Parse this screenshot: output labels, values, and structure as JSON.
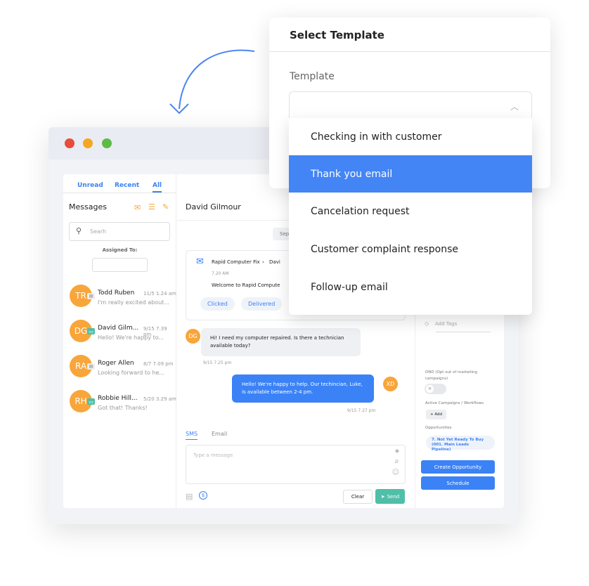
{
  "window": {
    "controls": [
      "close",
      "minimize",
      "maximize"
    ],
    "colors": {
      "close": "#e74c3c",
      "minimize": "#f5a623",
      "maximize": "#5dbb46"
    }
  },
  "sidebar": {
    "tabs": [
      {
        "label": "Unread"
      },
      {
        "label": "Recent"
      },
      {
        "label": "All",
        "active": true
      }
    ],
    "title": "Messages",
    "search_placeholder": "Searh",
    "assigned_label": "Assigned To:",
    "conversations": [
      {
        "initials": "TR",
        "name": "Todd Ruben",
        "time": "11/5 1.24 am",
        "preview": "I'm really excited about...",
        "channel": "email"
      },
      {
        "initials": "DG",
        "name": "David Gilm...",
        "time": "9/15 7.39 pm",
        "preview": "Hello! We're happy to...",
        "channel": "sms"
      },
      {
        "initials": "RA",
        "name": "Roger Allen",
        "time": "8/7 7.09 pm",
        "preview": "Looking forward to he...",
        "channel": "email"
      },
      {
        "initials": "RH",
        "name": "Robbie Hill...",
        "time": "5/20 3.29 am",
        "preview": "Got that! Thanks!",
        "channel": "sms"
      }
    ]
  },
  "chat": {
    "contact_name": "David Gilmour",
    "date_chip": "Sep",
    "email_card": {
      "from": "Rapid Computer Fix",
      "to": "Davi",
      "time": "7.20 AM",
      "subject": "Welcome to Rapid Compute",
      "statuses": [
        "Clicked",
        "Delivered"
      ]
    },
    "messages": [
      {
        "initials": "DG",
        "text": "Hi! I need my computer repaired. Is there a technician available today?",
        "time": "9/15 7.25 pm",
        "direction": "in"
      },
      {
        "initials": "XD",
        "text": "Hello! We're happy to help. Our techincian, Luke, is available between 2-4 pm.",
        "time": "9/15 7.27 pm",
        "direction": "out"
      }
    ],
    "composer": {
      "tabs": [
        "SMS",
        "Email"
      ],
      "active_tab": "SMS",
      "placeholder": "Type a message",
      "clear_label": "Clear",
      "send_label": "Send"
    }
  },
  "details": {
    "add_tags": "Add Tags",
    "dnd_label": "DND (Opt out of marketing campaigns)",
    "dnd_on": false,
    "campaigns_label": "Active Campaigns / Workflows",
    "add_label": "+ Add",
    "opportunities_label": "Opportunities",
    "opportunity": "7. Not Yet Ready To Buy (001. Main Leads Pipeline)",
    "create_opportunity": "Create Opportunity",
    "schedule": "Schedule"
  },
  "template_modal": {
    "title": "Select Template",
    "field_label": "Template",
    "options": [
      "Checking in with customer",
      "Thank you email",
      "Cancelation request",
      "Customer complaint response",
      "Follow-up email"
    ],
    "highlighted": "Thank you email"
  },
  "colors": {
    "accent": "#3b82f6",
    "avatar": "#f8a53a",
    "send": "#4fbfa8",
    "highlight": "#4385f5"
  }
}
